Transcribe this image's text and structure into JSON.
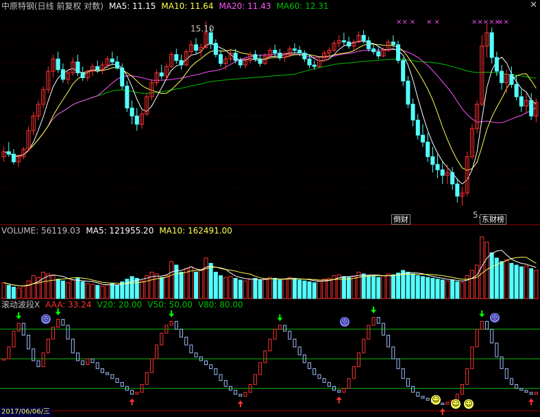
{
  "window": {
    "close_glyph": "✕"
  },
  "header": {
    "title": "中原特钢(日线 前复权 对数)",
    "ma5_label": "MA5: 11.15",
    "ma10_label": "MA10: 11.64",
    "ma20_label": "MA20: 11.43",
    "ma60_label": "MA60: 12.31"
  },
  "price_panel": {
    "high_label": "15.10",
    "low_label": "5.",
    "tags": [
      "倒财",
      "东财榜"
    ],
    "x_marks": [
      "×× ×",
      "× ×",
      "×××××",
      "××"
    ]
  },
  "volume_panel": {
    "vol_label": "VOLUME: 56119.03",
    "ma5_label": "MA5: 121955.20",
    "ma10_label": "MA10: 162491.00"
  },
  "indicator_panel": {
    "name": "滚动波段X",
    "aaa_label": "AAA: 33.24",
    "v20_label": "V20: 20.00",
    "v50_label": "V50: 50.00",
    "v80_label": "V80: 80.00"
  },
  "date_axis": {
    "label": "2017/06/06/三"
  },
  "colors": {
    "up": "#ff3232",
    "down": "#54ffff",
    "ma5": "#ffffff",
    "ma10": "#ffff54",
    "ma20": "#ff54ff",
    "ma60": "#00c000",
    "title": "#c0c0c0",
    "level_line": "#00c000",
    "panel_border": "#a00000"
  },
  "chart_data": {
    "type": "candlestick",
    "series": [
      {
        "name": "MA5",
        "value": 11.15
      },
      {
        "name": "MA10",
        "value": 11.64
      },
      {
        "name": "MA20",
        "value": 11.43
      },
      {
        "name": "MA60",
        "value": 12.31
      }
    ],
    "price_high": 15.1,
    "price_axis_range": [
      5,
      16
    ],
    "ohlc": [
      [
        7.2,
        7.6,
        7.0,
        7.4
      ],
      [
        7.4,
        7.8,
        7.2,
        7.3
      ],
      [
        7.3,
        7.5,
        6.9,
        7.0
      ],
      [
        7.0,
        7.3,
        6.8,
        7.2
      ],
      [
        7.2,
        7.6,
        7.1,
        7.5
      ],
      [
        7.5,
        8.5,
        7.4,
        8.3
      ],
      [
        8.3,
        9.2,
        8.1,
        9.0
      ],
      [
        9.0,
        9.8,
        8.8,
        9.6
      ],
      [
        9.6,
        10.6,
        9.4,
        10.4
      ],
      [
        10.4,
        11.8,
        10.2,
        11.5
      ],
      [
        11.5,
        12.6,
        11.1,
        12.3
      ],
      [
        12.3,
        12.8,
        11.4,
        11.6
      ],
      [
        11.6,
        12.0,
        10.8,
        11.0
      ],
      [
        11.0,
        11.6,
        10.7,
        11.4
      ],
      [
        11.4,
        12.4,
        11.2,
        12.1
      ],
      [
        12.1,
        12.6,
        11.2,
        11.4
      ],
      [
        11.4,
        11.8,
        10.9,
        11.1
      ],
      [
        11.1,
        11.6,
        10.9,
        11.5
      ],
      [
        11.5,
        12.0,
        11.2,
        11.8
      ],
      [
        11.8,
        12.2,
        11.4,
        11.6
      ],
      [
        11.6,
        12.1,
        11.3,
        11.9
      ],
      [
        11.9,
        12.5,
        11.7,
        12.3
      ],
      [
        12.3,
        12.8,
        11.9,
        12.1
      ],
      [
        12.1,
        12.5,
        11.6,
        11.7
      ],
      [
        11.7,
        12.0,
        10.4,
        10.6
      ],
      [
        10.6,
        10.9,
        9.2,
        9.4
      ],
      [
        9.4,
        9.8,
        8.6,
        9.0
      ],
      [
        9.0,
        9.4,
        8.3,
        8.6
      ],
      [
        8.6,
        9.3,
        8.4,
        9.1
      ],
      [
        9.1,
        10.2,
        9.0,
        10.0
      ],
      [
        10.0,
        11.0,
        9.8,
        10.8
      ],
      [
        10.8,
        11.6,
        10.6,
        11.4
      ],
      [
        11.4,
        11.9,
        11.0,
        11.2
      ],
      [
        11.2,
        12.0,
        11.0,
        11.8
      ],
      [
        11.8,
        12.8,
        11.7,
        12.6
      ],
      [
        12.6,
        13.0,
        12.0,
        12.2
      ],
      [
        12.2,
        12.6,
        11.6,
        11.9
      ],
      [
        11.9,
        13.0,
        11.8,
        12.8
      ],
      [
        12.8,
        13.6,
        12.5,
        13.3
      ],
      [
        13.3,
        13.8,
        12.6,
        12.9
      ],
      [
        12.9,
        13.4,
        12.4,
        13.1
      ],
      [
        13.1,
        15.1,
        13.0,
        14.2
      ],
      [
        14.2,
        14.6,
        13.0,
        13.4
      ],
      [
        13.4,
        13.7,
        12.4,
        12.6
      ],
      [
        12.6,
        12.9,
        11.8,
        12.0
      ],
      [
        12.0,
        12.5,
        11.6,
        12.3
      ],
      [
        12.3,
        12.9,
        12.1,
        12.7
      ],
      [
        12.7,
        13.0,
        12.0,
        12.2
      ],
      [
        12.2,
        12.4,
        11.7,
        11.9
      ],
      [
        11.9,
        12.4,
        11.7,
        12.2
      ],
      [
        12.2,
        12.8,
        12.0,
        12.6
      ],
      [
        12.6,
        12.9,
        12.1,
        12.3
      ],
      [
        12.3,
        12.6,
        11.8,
        12.0
      ],
      [
        12.0,
        12.7,
        11.9,
        12.5
      ],
      [
        12.5,
        13.1,
        12.3,
        12.9
      ],
      [
        12.9,
        13.3,
        12.5,
        12.7
      ],
      [
        12.7,
        13.0,
        12.2,
        12.4
      ],
      [
        12.4,
        12.8,
        12.1,
        12.6
      ],
      [
        12.6,
        13.2,
        12.4,
        13.0
      ],
      [
        13.0,
        13.4,
        12.7,
        12.9
      ],
      [
        12.9,
        13.2,
        12.5,
        12.7
      ],
      [
        12.7,
        12.9,
        12.1,
        12.3
      ],
      [
        12.3,
        12.6,
        11.7,
        11.9
      ],
      [
        11.9,
        12.2,
        11.6,
        11.8
      ],
      [
        11.8,
        12.4,
        11.7,
        12.2
      ],
      [
        12.2,
        12.9,
        12.1,
        12.7
      ],
      [
        12.7,
        13.1,
        12.4,
        12.9
      ],
      [
        12.9,
        13.6,
        12.8,
        13.4
      ],
      [
        13.4,
        14.0,
        13.1,
        13.6
      ],
      [
        13.6,
        14.2,
        13.2,
        13.5
      ],
      [
        13.5,
        13.9,
        13.0,
        13.2
      ],
      [
        13.2,
        13.7,
        12.9,
        13.5
      ],
      [
        13.5,
        14.3,
        13.4,
        14.0
      ],
      [
        14.0,
        14.4,
        13.4,
        13.6
      ],
      [
        13.6,
        13.9,
        12.8,
        13.0
      ],
      [
        13.0,
        13.4,
        12.6,
        12.8
      ],
      [
        12.8,
        13.2,
        12.3,
        12.5
      ],
      [
        12.5,
        13.1,
        12.4,
        12.9
      ],
      [
        12.9,
        13.7,
        12.8,
        13.5
      ],
      [
        13.5,
        14.0,
        13.1,
        13.3
      ],
      [
        13.3,
        13.6,
        12.0,
        12.2
      ],
      [
        12.2,
        12.4,
        10.6,
        10.9
      ],
      [
        10.9,
        11.2,
        9.4,
        9.6
      ],
      [
        9.6,
        9.9,
        8.5,
        8.8
      ],
      [
        8.8,
        9.1,
        7.9,
        8.1
      ],
      [
        8.1,
        8.6,
        7.6,
        7.8
      ],
      [
        7.8,
        8.2,
        7.0,
        7.2
      ],
      [
        7.2,
        7.6,
        6.6,
        6.9
      ],
      [
        6.9,
        7.3,
        6.4,
        6.7
      ],
      [
        6.7,
        7.0,
        6.2,
        6.5
      ],
      [
        6.5,
        6.9,
        6.2,
        6.6
      ],
      [
        6.6,
        6.8,
        6.0,
        6.2
      ],
      [
        6.2,
        6.4,
        5.6,
        5.8
      ],
      [
        5.8,
        6.1,
        5.5,
        5.9
      ],
      [
        5.9,
        7.4,
        5.8,
        7.2
      ],
      [
        7.2,
        8.6,
        7.1,
        8.4
      ],
      [
        8.4,
        9.8,
        8.2,
        9.6
      ],
      [
        9.6,
        14.0,
        9.5,
        13.2
      ],
      [
        13.2,
        14.9,
        12.4,
        14.2
      ],
      [
        14.2,
        14.6,
        12.0,
        12.4
      ],
      [
        12.4,
        12.8,
        11.2,
        11.5
      ],
      [
        11.5,
        11.9,
        10.4,
        10.8
      ],
      [
        10.8,
        11.6,
        10.2,
        11.3
      ],
      [
        11.3,
        11.8,
        10.5,
        10.7
      ],
      [
        10.7,
        11.2,
        9.8,
        10.0
      ],
      [
        10.0,
        10.4,
        9.2,
        9.5
      ],
      [
        9.5,
        10.2,
        9.1,
        9.8
      ],
      [
        9.8,
        10.2,
        8.8,
        9.0
      ],
      [
        9.0,
        9.9,
        8.7,
        9.7
      ]
    ],
    "volume_axis_max": 700000,
    "volume": [
      180,
      150,
      130,
      120,
      140,
      200,
      260,
      240,
      300,
      280,
      260,
      220,
      200,
      180,
      210,
      230,
      190,
      170,
      160,
      150,
      140,
      160,
      170,
      150,
      190,
      220,
      250,
      230,
      200,
      260,
      300,
      280,
      240,
      260,
      420,
      380,
      300,
      340,
      360,
      300,
      320,
      460,
      400,
      300,
      260,
      240,
      250,
      230,
      210,
      200,
      220,
      230,
      210,
      220,
      240,
      230,
      210,
      220,
      240,
      230,
      210,
      200,
      190,
      180,
      200,
      220,
      230,
      260,
      270,
      250,
      240,
      250,
      300,
      280,
      260,
      250,
      240,
      260,
      280,
      270,
      290,
      320,
      300,
      280,
      260,
      250,
      240,
      230,
      220,
      210,
      200,
      210,
      190,
      180,
      260,
      320,
      380,
      700,
      640,
      520,
      460,
      420,
      440,
      400,
      380,
      360,
      370,
      340,
      320
    ],
    "indicator_levels": [
      20,
      50,
      80
    ],
    "indicator_axis_range": [
      0,
      100
    ],
    "indicator": [
      50,
      62,
      78,
      86,
      74,
      60,
      48,
      42,
      56,
      70,
      82,
      90,
      84,
      70,
      56,
      48,
      44,
      50,
      46,
      40,
      36,
      34,
      30,
      26,
      22,
      18,
      14,
      16,
      24,
      36,
      50,
      64,
      76,
      84,
      88,
      80,
      72,
      64,
      56,
      52,
      48,
      44,
      40,
      34,
      28,
      22,
      18,
      14,
      12,
      16,
      24,
      34,
      46,
      58,
      70,
      80,
      84,
      78,
      70,
      62,
      54,
      46,
      40,
      34,
      30,
      26,
      22,
      18,
      16,
      20,
      30,
      42,
      56,
      70,
      84,
      92,
      86,
      74,
      62,
      50,
      40,
      30,
      22,
      16,
      12,
      10,
      8,
      6,
      5,
      4,
      6,
      8,
      14,
      24,
      40,
      62,
      80,
      88,
      80,
      66,
      52,
      40,
      30,
      24,
      20,
      18,
      16,
      14,
      16
    ]
  }
}
